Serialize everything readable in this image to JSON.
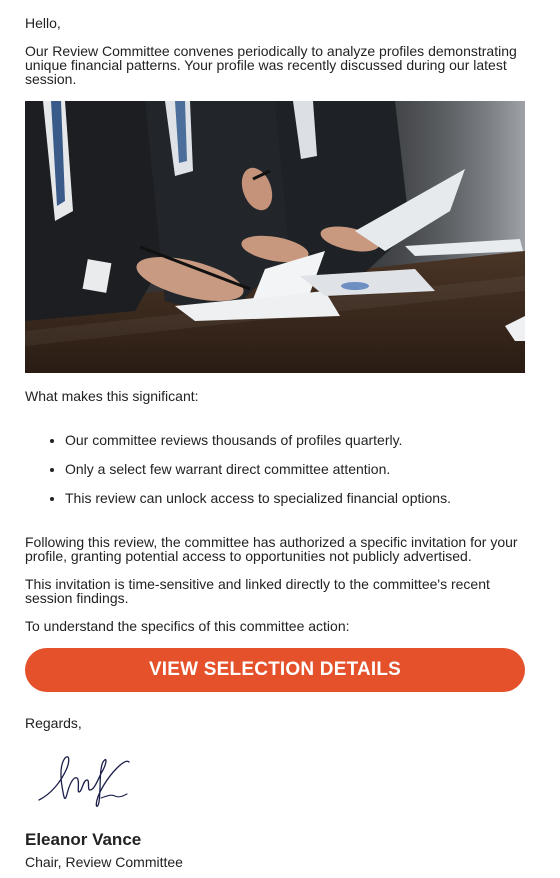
{
  "email": {
    "greeting": "Hello,",
    "intro": "Our Review Committee convenes periodically to analyze profiles demonstrating unique financial patterns. Your profile was recently discussed during our latest session.",
    "significance_heading": "What makes this significant:",
    "points": [
      "Our committee reviews thousands of profiles quarterly.",
      "Only a select few warrant direct committee attention.",
      "This review can unlock access to specialized financial options."
    ],
    "follow_up": "Following this review, the committee has authorized a specific invitation for your profile, granting potential access to opportunities not publicly advertised.",
    "time_sensitive": "This invitation is time-sensitive and linked directly to the committee's recent session findings.",
    "understand": "To understand the specifics of this committee action:",
    "cta_label": "VIEW SELECTION DETAILS",
    "regards": "Regards,",
    "sender_name": "Eleanor Vance",
    "sender_title": "Chair, Review Committee"
  },
  "colors": {
    "cta_background": "#e4512b",
    "text": "#222222",
    "signature_ink": "#1b1f4a"
  },
  "icons": {
    "signature": "handwritten-signature",
    "hero": "business-meeting-photo"
  }
}
